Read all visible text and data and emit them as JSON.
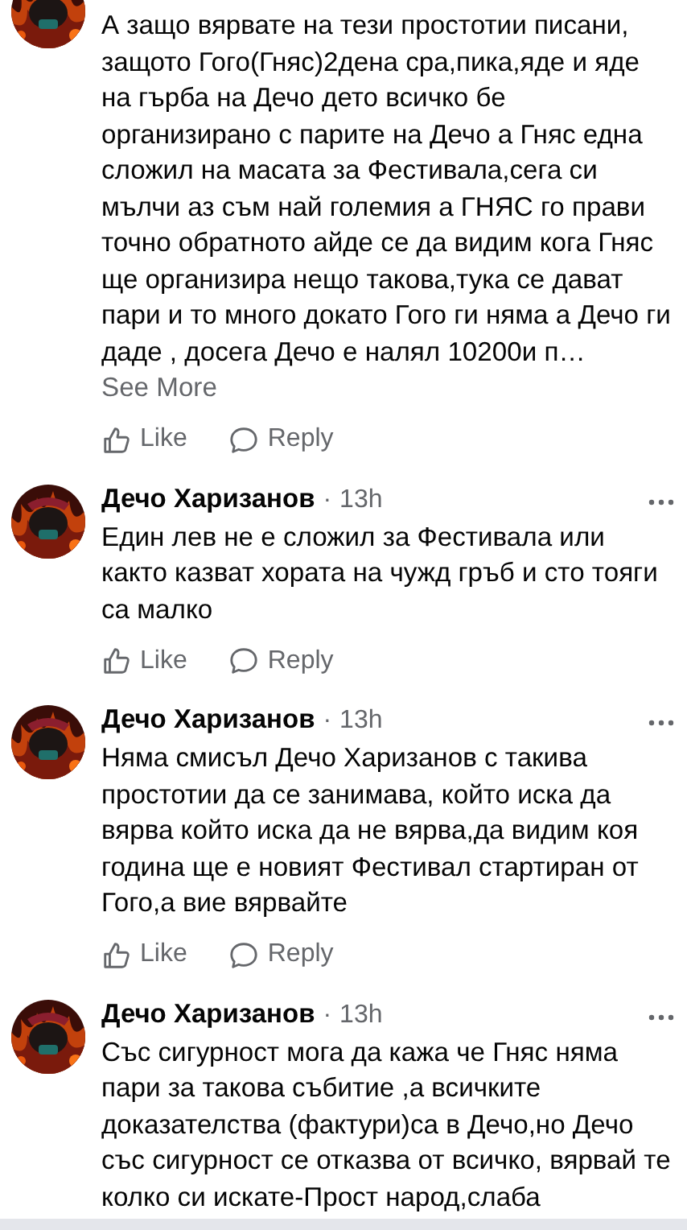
{
  "comments": [
    {
      "text": "А защо вярвате на тези простотии писани, защото Гого(Гняс)2дена сра,пика,яде и яде на гърба на Дечо дето всичко бе организирано с парите на Дечо а Гняс една сложил на масата за Фестивала,сега си мълчи аз съм най големия а ГНЯС го прави точно обратното айде се да видим кога Гняс ще организира нещо такова,тука се дават пари и то много докато Гого ги няма а Дечо ги даде , досега Дечо е налял 10200и п…",
      "see_more": "See More",
      "actions": [
        "Like",
        "Reply"
      ]
    },
    {
      "author": "Дечо Харизанов",
      "separator": "·",
      "time": "13h",
      "text": "Един лев не е сложил за Фестивала или както казват хората на чужд гръб и сто тояги са малко",
      "actions": [
        "Like",
        "Reply"
      ]
    },
    {
      "author": "Дечо Харизанов",
      "separator": "·",
      "time": "13h",
      "text": "Няма смисъл Дечо Харизанов с такива простотии да се занимава, който иска да вярва който иска да не вярва,да видим коя година ще е новият Фестивал стартиран от Гого,а вие вярвайте",
      "actions": [
        "Like",
        "Reply"
      ]
    },
    {
      "author": "Дечо Харизанов",
      "separator": "·",
      "time": "13h",
      "text": "Със сигурност мога да кажа че Гняс няма пари за такова събитие ,а всичките доказателства (фактури)са в Дечо,но Дечо със сигурност се отказва от всичко, вярвай те колко си искате-Прост народ,слаба"
    }
  ]
}
